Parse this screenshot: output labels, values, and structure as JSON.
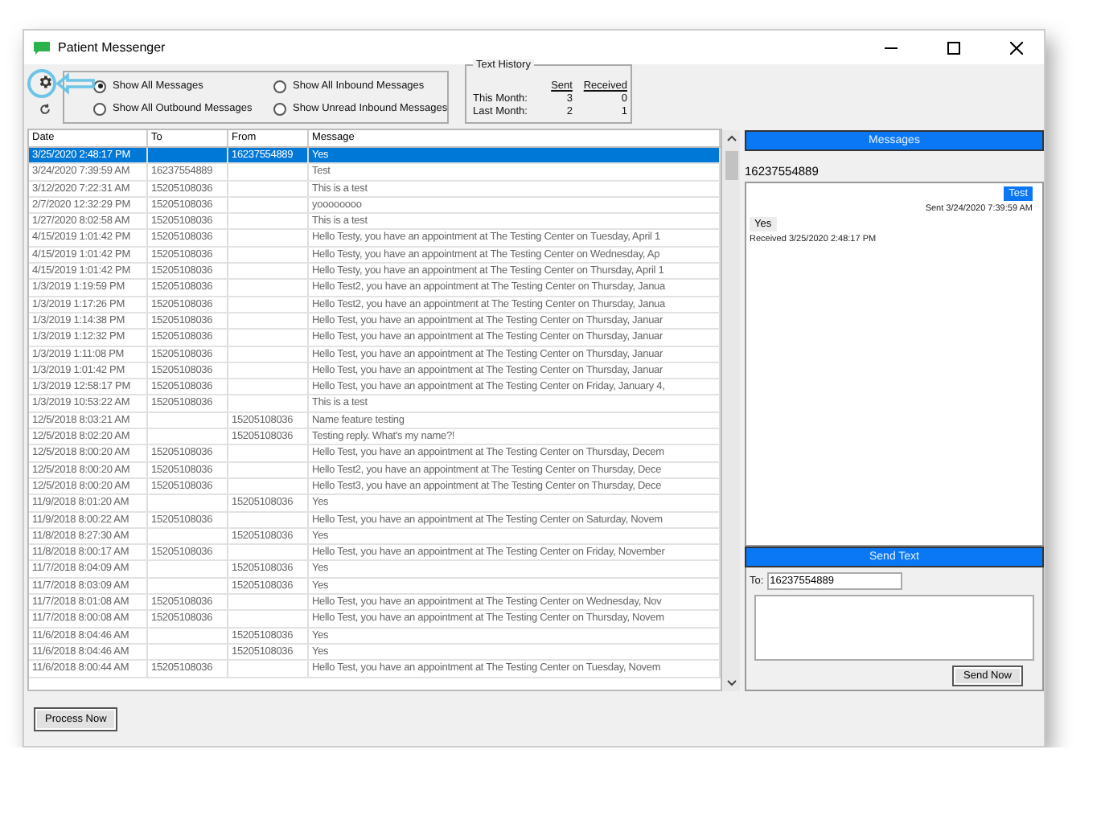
{
  "window": {
    "title": "Patient Messenger"
  },
  "filters": [
    {
      "label": "Show All Messages",
      "selected": true
    },
    {
      "label": "Show All Inbound Messages",
      "selected": false
    },
    {
      "label": "Show All Outbound Messages",
      "selected": false
    },
    {
      "label": "Show Unread Inbound Messages",
      "selected": false
    }
  ],
  "text_history": {
    "title": "Text History",
    "columns": [
      "Sent",
      "Received"
    ],
    "rows": [
      {
        "label": "This Month:",
        "values": [
          "3",
          "0"
        ]
      },
      {
        "label": "Last Month:",
        "values": [
          "2",
          "1"
        ]
      }
    ]
  },
  "table": {
    "columns": [
      "Date",
      "To",
      "From",
      "Message"
    ],
    "rows": [
      {
        "selected": true,
        "cells": [
          "3/25/2020 2:48:17 PM",
          "",
          "16237554889",
          "Yes"
        ]
      },
      {
        "selected": false,
        "cells": [
          "3/24/2020 7:39:59 AM",
          "16237554889",
          "",
          "Test"
        ]
      },
      {
        "selected": false,
        "cells": [
          "3/12/2020 7:22:31 AM",
          "15205108036",
          "",
          "This is a test"
        ]
      },
      {
        "selected": false,
        "cells": [
          "2/7/2020 12:32:29 PM",
          "15205108036",
          "",
          "yoooooooo"
        ]
      },
      {
        "selected": false,
        "cells": [
          "1/27/2020 8:02:58 AM",
          "15205108036",
          "",
          "This is a test"
        ]
      },
      {
        "selected": false,
        "cells": [
          "4/15/2019 1:01:42 PM",
          "15205108036",
          "",
          "Hello Testy, you have an appointment at The Testing Center on Tuesday, April 1"
        ]
      },
      {
        "selected": false,
        "cells": [
          "4/15/2019 1:01:42 PM",
          "15205108036",
          "",
          "Hello Testy, you have an appointment at The Testing Center on Wednesday, Ap"
        ]
      },
      {
        "selected": false,
        "cells": [
          "4/15/2019 1:01:42 PM",
          "15205108036",
          "",
          "Hello Testy, you have an appointment at The Testing Center on Thursday, April 1"
        ]
      },
      {
        "selected": false,
        "cells": [
          "1/3/2019 1:19:59 PM",
          "15205108036",
          "",
          "Hello Test2, you have an appointment at The Testing Center on Thursday, Janua"
        ]
      },
      {
        "selected": false,
        "cells": [
          "1/3/2019 1:17:26 PM",
          "15205108036",
          "",
          "Hello Test2, you have an appointment at The Testing Center on Thursday, Janua"
        ]
      },
      {
        "selected": false,
        "cells": [
          "1/3/2019 1:14:38 PM",
          "15205108036",
          "",
          "Hello Test, you have an appointment at The Testing Center on Thursday, Januar"
        ]
      },
      {
        "selected": false,
        "cells": [
          "1/3/2019 1:12:32 PM",
          "15205108036",
          "",
          "Hello Test, you have an appointment at The Testing Center on Thursday, Januar"
        ]
      },
      {
        "selected": false,
        "cells": [
          "1/3/2019 1:11:08 PM",
          "15205108036",
          "",
          "Hello Test, you have an appointment at The Testing Center on Thursday, Januar"
        ]
      },
      {
        "selected": false,
        "cells": [
          "1/3/2019 1:01:42 PM",
          "15205108036",
          "",
          "Hello Test, you have an appointment at The Testing Center on Thursday, Januar"
        ]
      },
      {
        "selected": false,
        "cells": [
          "1/3/2019 12:58:17 PM",
          "15205108036",
          "",
          "Hello Test, you have an appointment at The Testing Center on Friday, January 4,"
        ]
      },
      {
        "selected": false,
        "cells": [
          "1/3/2019 10:53:22 AM",
          "15205108036",
          "",
          "This is a test"
        ]
      },
      {
        "selected": false,
        "cells": [
          "12/5/2018 8:03:21 AM",
          "",
          "15205108036",
          "Name feature testing"
        ]
      },
      {
        "selected": false,
        "cells": [
          "12/5/2018 8:02:20 AM",
          "",
          "15205108036",
          "Testing reply. What's my name?!"
        ]
      },
      {
        "selected": false,
        "cells": [
          "12/5/2018 8:00:20 AM",
          "15205108036",
          "",
          "Hello Test, you have an appointment at The Testing Center on Thursday, Decem"
        ]
      },
      {
        "selected": false,
        "cells": [
          "12/5/2018 8:00:20 AM",
          "15205108036",
          "",
          "Hello Test2, you have an appointment at The Testing Center on Thursday, Dece"
        ]
      },
      {
        "selected": false,
        "cells": [
          "12/5/2018 8:00:20 AM",
          "15205108036",
          "",
          "Hello Test3, you have an appointment at The Testing Center on Thursday, Dece"
        ]
      },
      {
        "selected": false,
        "cells": [
          "11/9/2018 8:01:20 AM",
          "",
          "15205108036",
          "Yes"
        ]
      },
      {
        "selected": false,
        "cells": [
          "11/9/2018 8:00:22 AM",
          "15205108036",
          "",
          "Hello Test, you have an appointment at The Testing Center on Saturday, Novem"
        ]
      },
      {
        "selected": false,
        "cells": [
          "11/8/2018 8:27:30 AM",
          "",
          "15205108036",
          "Yes"
        ]
      },
      {
        "selected": false,
        "cells": [
          "11/8/2018 8:00:17 AM",
          "15205108036",
          "",
          "Hello Test, you have an appointment at The Testing Center on Friday, November"
        ]
      },
      {
        "selected": false,
        "cells": [
          "11/7/2018 8:04:09 AM",
          "",
          "15205108036",
          "Yes"
        ]
      },
      {
        "selected": false,
        "cells": [
          "11/7/2018 8:03:09 AM",
          "",
          "15205108036",
          "Yes"
        ]
      },
      {
        "selected": false,
        "cells": [
          "11/7/2018 8:01:08 AM",
          "15205108036",
          "",
          "Hello Test, you have an appointment at The Testing Center on Wednesday, Nov"
        ]
      },
      {
        "selected": false,
        "cells": [
          "11/7/2018 8:00:08 AM",
          "15205108036",
          "",
          "Hello Test, you have an appointment at The Testing Center on Thursday, Novem"
        ]
      },
      {
        "selected": false,
        "cells": [
          "11/6/2018 8:04:46 AM",
          "",
          "15205108036",
          "Yes"
        ]
      },
      {
        "selected": false,
        "cells": [
          "11/6/2018 8:04:46 AM",
          "",
          "15205108036",
          "Yes"
        ]
      },
      {
        "selected": false,
        "cells": [
          "11/6/2018 8:00:44 AM",
          "15205108036",
          "",
          "Hello Test, you have an appointment at The Testing Center on Tuesday, Novem"
        ]
      }
    ]
  },
  "process_button": "Process Now",
  "messages_panel": {
    "title": "Messages",
    "contact": "16237554889",
    "bubbles": [
      {
        "kind": "sent",
        "text": "Test",
        "meta": "Sent 3/24/2020 7:39:59 AM"
      },
      {
        "kind": "received",
        "text": "Yes",
        "meta": "Received 3/25/2020 2:48:17 PM"
      }
    ]
  },
  "send_panel": {
    "title": "Send Text",
    "to_label": "To:",
    "to_value": "16237554889",
    "button": "Send Now"
  }
}
